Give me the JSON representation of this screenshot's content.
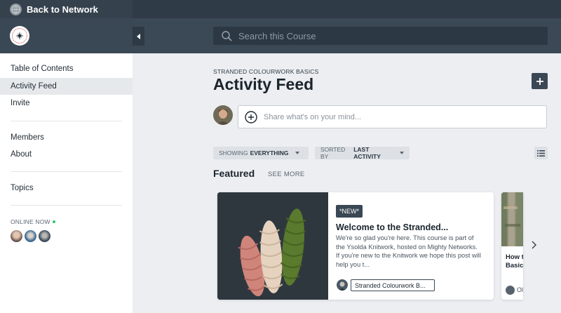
{
  "topbar": {
    "back_label": "Back to Network"
  },
  "search": {
    "placeholder": "Search this Course"
  },
  "sidebar": {
    "items": [
      {
        "label": "Table of Contents"
      },
      {
        "label": "Activity Feed"
      },
      {
        "label": "Invite"
      },
      {
        "label": "Members"
      },
      {
        "label": "About"
      },
      {
        "label": "Topics"
      }
    ],
    "online_label": "ONLINE NOW"
  },
  "main": {
    "course_label": "STRANDED COLOURWORK BASICS",
    "title": "Activity Feed",
    "share_placeholder": "Share what's on your mind...",
    "filters": {
      "showing_prefix": "SHOWING",
      "showing_value": "EVERYTHING",
      "sorted_prefix": "SORTED BY",
      "sorted_value": "LAST ACTIVITY"
    },
    "featured": {
      "title": "Featured",
      "see_more": "SEE MORE"
    },
    "cards": [
      {
        "badge": "*NEW*",
        "title": "Welcome to the Stranded...",
        "excerpt": "We're so glad you're here. This course is part of the Ysolda Knitwork, hosted on Mighty Networks. If you're new to the Knitwork we hope this post will help you t...",
        "space": "Stranded Colourwork B..."
      },
      {
        "title": "How t Knitw Basics",
        "meta": "Ol"
      }
    ]
  },
  "colors": {
    "topbar": "#2f3b47",
    "accent_dark": "#3a4754",
    "online": "#33c46c"
  },
  "icons": [
    "globe-icon",
    "collapse-icon",
    "search-icon",
    "plus-icon",
    "add-circle-icon",
    "caret-down-icon",
    "list-view-icon",
    "chevron-right-icon"
  ]
}
